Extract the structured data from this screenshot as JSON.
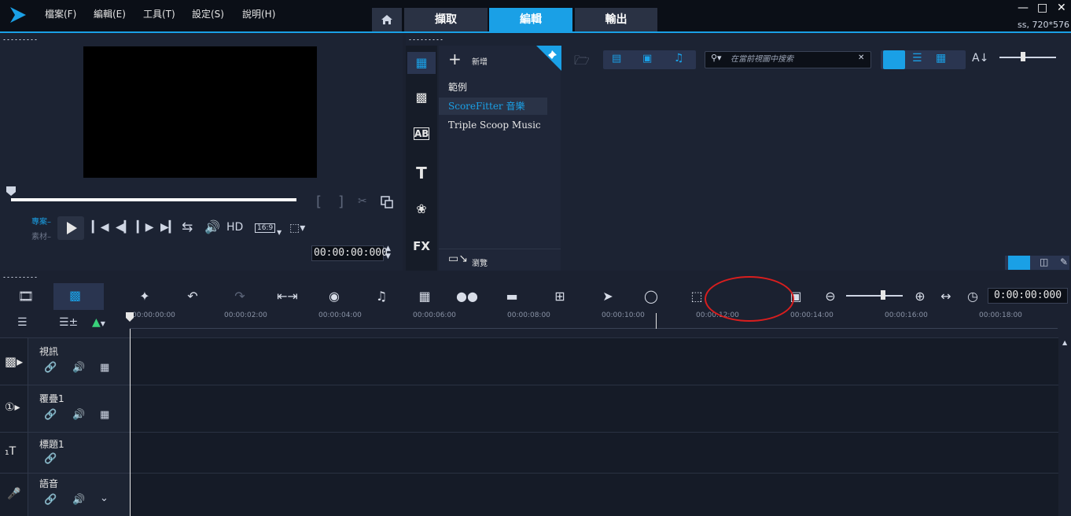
{
  "menu": [
    "檔案(F)",
    "編輯(E)",
    "工具(T)",
    "設定(S)",
    "說明(H)"
  ],
  "tabs": {
    "capture": "擷取",
    "edit": "編輯",
    "share": "輸出"
  },
  "resolution": "ss, 720*576",
  "player": {
    "project_label": "專案",
    "clip_label": "素材",
    "hd_label": "HD",
    "aspect_label": "16:9",
    "timecode": "00:00:00:000"
  },
  "library": {
    "add_label": "新增",
    "tree": [
      "範例",
      "ScoreFitter 音樂",
      "Triple Scoop Music"
    ],
    "browse_label": "瀏覽",
    "search_placeholder": "在當前視圖中搜索"
  },
  "timeline": {
    "timecode": "0:00:00:000",
    "ticks": [
      "00:00:00:00",
      "00:00:02:00",
      "00:00:04:00",
      "00:00:06:00",
      "00:00:08:00",
      "00:00:10:00",
      "00:00:12:00",
      "00:00:14:00",
      "00:00:16:00",
      "00:00:18:00"
    ],
    "tracks": [
      "視訊",
      "覆疊1",
      "標題1",
      "語音"
    ]
  },
  "colors": {
    "accent": "#1aa0e6",
    "annotation": "#d91e1e"
  }
}
